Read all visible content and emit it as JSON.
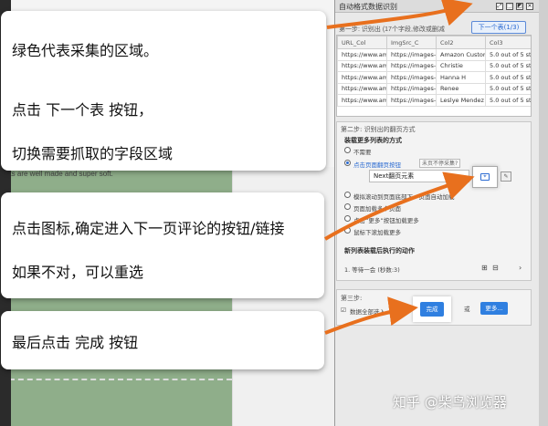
{
  "callouts": {
    "c1": {
      "line1": "绿色代表采集的区域。",
      "line2": "点击 下一个表 按钮，",
      "line3": "切换需要抓取的字段区域"
    },
    "c2": {
      "line1": "点击图标,确定进入下一页评论的按钮/链接",
      "line2": "如果不对，可以重选"
    },
    "c3": {
      "line1": "最后点击 完成 按钮"
    }
  },
  "webpage": {
    "snippet": "kets are well made and super soft."
  },
  "panel": {
    "title": "自动格式数据识别",
    "header_icons": [
      "⤢",
      "⬚",
      "◩",
      "✕"
    ],
    "step1_label": "第一步: 识别出 (17个字段,修改或删减",
    "next_table_label": "下一个表(1/3)",
    "table": {
      "headers": [
        "URL_Col",
        "ImgSrc_C",
        "Col2",
        "Col3"
      ],
      "rows": [
        [
          "https://www.am...",
          "https://images-n...",
          "Amazon Customer",
          "5.0 out of 5 st..."
        ],
        [
          "https://www.am...",
          "https://images-n...",
          "Christie",
          "5.0 out of 5 st..."
        ],
        [
          "https://www.am...",
          "https://images-n...",
          "Hanna H",
          "5.0 out of 5 st..."
        ],
        [
          "https://www.am...",
          "https://images-n...",
          "Renee",
          "5.0 out of 5 st..."
        ],
        [
          "https://www.am...",
          "https://images-n...",
          "Leslye Mendez",
          "5.0 out of 5 st..."
        ]
      ]
    },
    "step2": {
      "label": "第二步: 识别出的翻页方式",
      "load_more_label": "装载更多列表的方式",
      "opt_none": "不需要",
      "opt_click_next": "点击页面翻页按钮",
      "tag_wrong": "未页不停采集?",
      "next_page_value": "Next翻页元素",
      "opt_scroll": "模拟滚动到页面底部下一页面自动加载",
      "opt_multi": "页面加载多个页面",
      "opt_click_more": "点击“更多”按钮加载更多",
      "opt_wheel": "鼠标下滚加载更多",
      "after_label": "新列表装载后执行的动作",
      "wait_label": "1. 等待一会 (秒数:3)"
    },
    "step3": {
      "label": "第三步:",
      "check_label": "数据全部选入",
      "done_label": "完成",
      "or_label": "或",
      "more_label": "更多..."
    }
  },
  "watermark": "知乎 @柴鸟浏览器"
}
